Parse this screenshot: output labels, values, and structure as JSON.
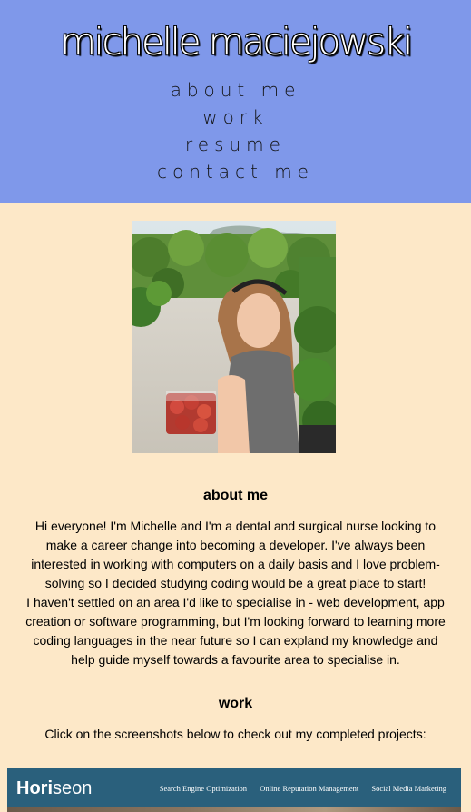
{
  "header": {
    "title": "michelle maciejowski",
    "nav": [
      {
        "label": "about me"
      },
      {
        "label": "work"
      },
      {
        "label": "resume"
      },
      {
        "label": "contact me"
      }
    ]
  },
  "about": {
    "heading": "about me",
    "paragraph_lines": [
      "Hi everyone! I'm Michelle and I'm a dental and surgical nurse looking to",
      "make a career change into becoming a developer. I've always been",
      "interested in working with computers on a daily basis and I love problem-",
      "solving so I decided studying coding would be a great place to start!",
      "I haven't settled on an area I'd like to specialise in - web development, app",
      "creation or software programming, but I'm looking forward to learning more",
      "coding languages in the near future so I can expland my knowledge and",
      "help guide myself towards a favourite area to specialise in."
    ]
  },
  "work": {
    "heading": "work",
    "intro": "Click on the screenshots below to check out my completed projects:",
    "projects": [
      {
        "logo_bold": "Hori",
        "logo_light": "seon",
        "nav": [
          "Search Engine Optimization",
          "Online Reputation Management",
          "Social Media Marketing"
        ]
      }
    ]
  },
  "colors": {
    "header_bg": "#7f98ea",
    "page_bg": "#fde8c8",
    "project_bg": "#2a607c"
  }
}
